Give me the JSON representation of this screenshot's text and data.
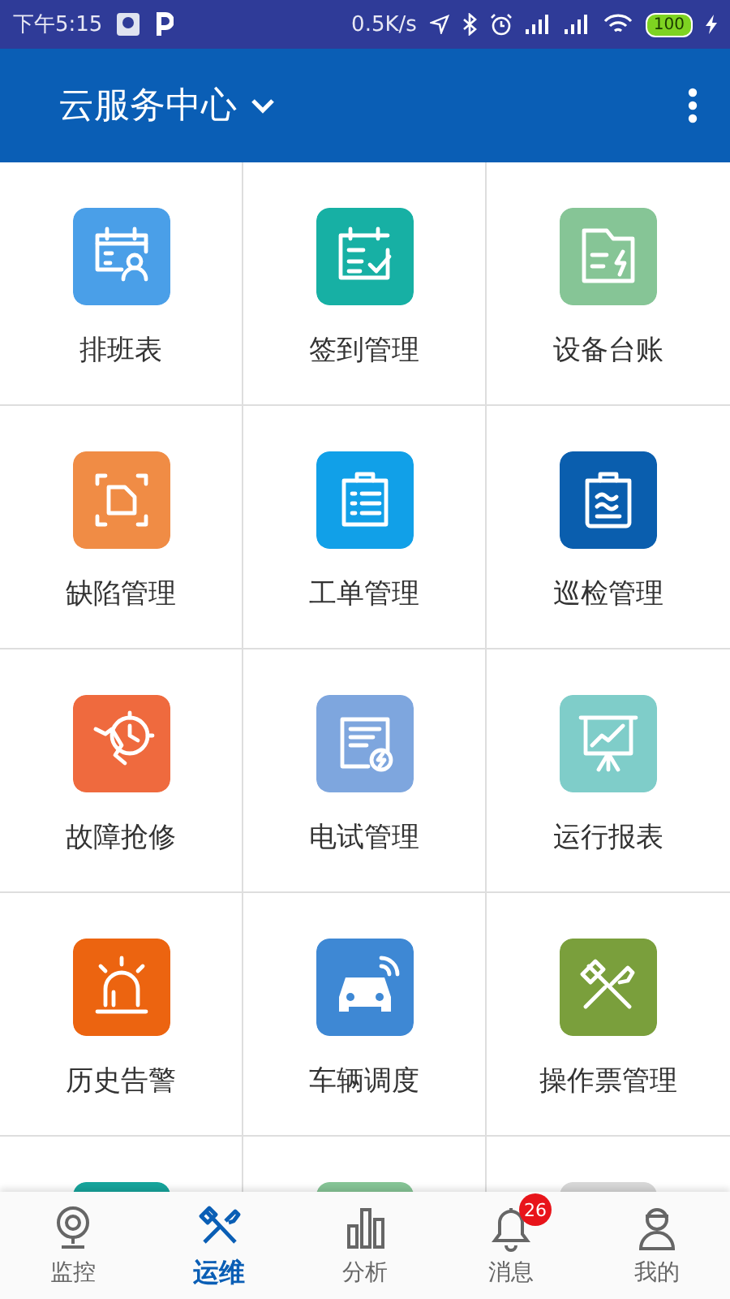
{
  "status_bar": {
    "time": "下午5:15",
    "net_speed": "0.5K/s",
    "battery": "100"
  },
  "app_bar": {
    "title": "云服务中心"
  },
  "tiles": [
    {
      "label": "排班表",
      "color": "#4a9fe8"
    },
    {
      "label": "签到管理",
      "color": "#17b0a4"
    },
    {
      "label": "设备台账",
      "color": "#86c596"
    },
    {
      "label": "缺陷管理",
      "color": "#f08c45"
    },
    {
      "label": "工单管理",
      "color": "#11a0e8"
    },
    {
      "label": "巡检管理",
      "color": "#0a5eae"
    },
    {
      "label": "故障抢修",
      "color": "#ef6a3e"
    },
    {
      "label": "电试管理",
      "color": "#7ea6de"
    },
    {
      "label": "运行报表",
      "color": "#7fcdc9"
    },
    {
      "label": "历史告警",
      "color": "#ec6410"
    },
    {
      "label": "车辆调度",
      "color": "#3e88d4"
    },
    {
      "label": "操作票管理",
      "color": "#7a9f3c"
    },
    {
      "color": "#17a59c"
    },
    {
      "color": "#86c596"
    },
    {
      "color": "#d8d8d8"
    }
  ],
  "nav": [
    {
      "label": "监控",
      "selected": false
    },
    {
      "label": "运维",
      "selected": true
    },
    {
      "label": "分析",
      "selected": false
    },
    {
      "label": "消息",
      "selected": false,
      "badge": "26"
    },
    {
      "label": "我的",
      "selected": false
    }
  ]
}
